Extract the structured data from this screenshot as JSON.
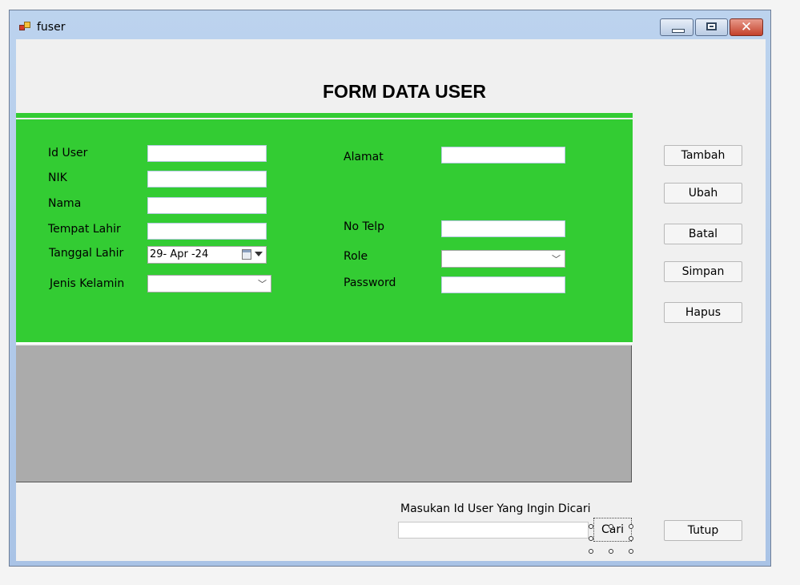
{
  "window": {
    "title": "fuser",
    "app_icon": "winforms-form-icon"
  },
  "caption_buttons": {
    "minimize": "minimize-icon",
    "maximize": "maximize-icon",
    "close": "close-icon",
    "close_glyph": "✕"
  },
  "form": {
    "title": "FORM DATA USER",
    "panel_color": "#33cc33",
    "grid_color": "#ababab",
    "fields": {
      "id_user": {
        "label": "Id User",
        "value": ""
      },
      "nik": {
        "label": "NIK",
        "value": ""
      },
      "nama": {
        "label": "Nama",
        "value": ""
      },
      "tempat_lahir": {
        "label": "Tempat Lahir",
        "value": ""
      },
      "tanggal_lahir": {
        "label": "Tanggal Lahir",
        "value": "29- Apr -24"
      },
      "jenis_kelamin": {
        "label": "Jenis Kelamin",
        "value": ""
      },
      "alamat": {
        "label": "Alamat",
        "value": ""
      },
      "no_telp": {
        "label": "No Telp",
        "value": ""
      },
      "role": {
        "label": "Role",
        "value": ""
      },
      "password": {
        "label": "Password",
        "value": ""
      }
    }
  },
  "actions": {
    "tambah": "Tambah",
    "ubah": "Ubah",
    "batal": "Batal",
    "simpan": "Simpan",
    "hapus": "Hapus",
    "tutup": "Tutup"
  },
  "search": {
    "label": "Masukan Id User Yang Ingin Dicari",
    "value": "",
    "button": "Cari"
  }
}
